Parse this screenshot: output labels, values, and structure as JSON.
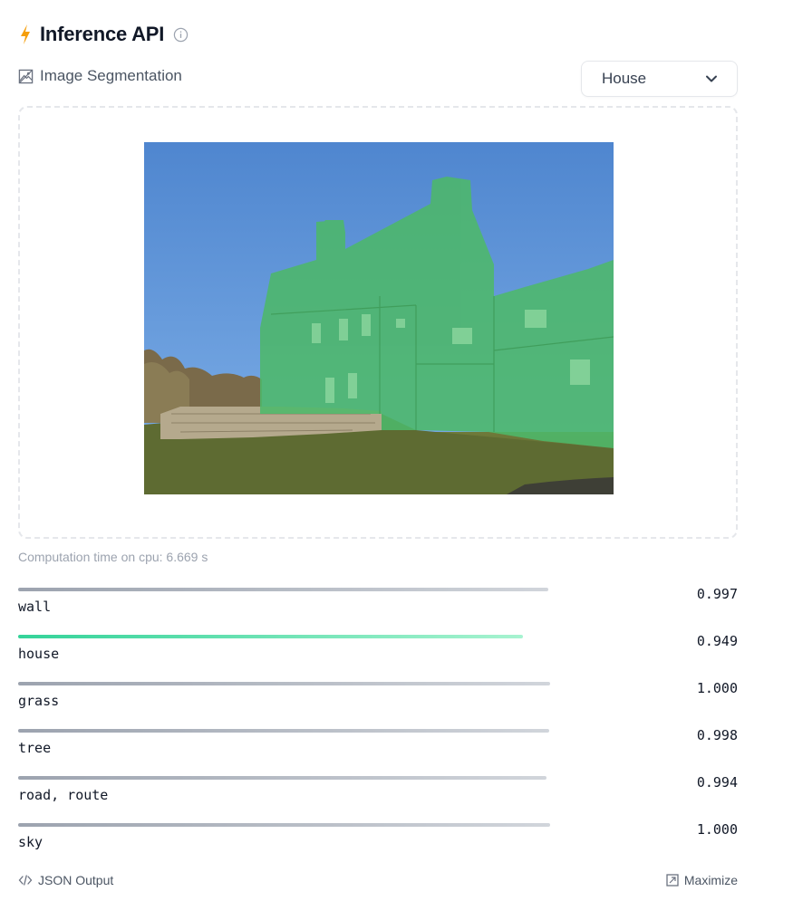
{
  "header": {
    "title": "Inference API"
  },
  "task": {
    "label": "Image Segmentation"
  },
  "select": {
    "value": "House"
  },
  "computation": {
    "text": "Computation time on cpu: 6.669 s"
  },
  "results": [
    {
      "label": "wall",
      "score": "0.997",
      "fill": 0.997,
      "color": "#9ca3af"
    },
    {
      "label": "house",
      "score": "0.949",
      "fill": 0.949,
      "color": "#34d399"
    },
    {
      "label": "grass",
      "score": "1.000",
      "fill": 1.0,
      "color": "#9ca3af"
    },
    {
      "label": "tree",
      "score": "0.998",
      "fill": 0.998,
      "color": "#9ca3af"
    },
    {
      "label": "road, route",
      "score": "0.994",
      "fill": 0.994,
      "color": "#9ca3af"
    },
    {
      "label": "sky",
      "score": "1.000",
      "fill": 1.0,
      "color": "#9ca3af"
    }
  ],
  "footer": {
    "json_output": "JSON Output",
    "maximize": "Maximize"
  },
  "colors": {
    "accent": "#f59e0b",
    "house_mask": "#4ade80"
  }
}
